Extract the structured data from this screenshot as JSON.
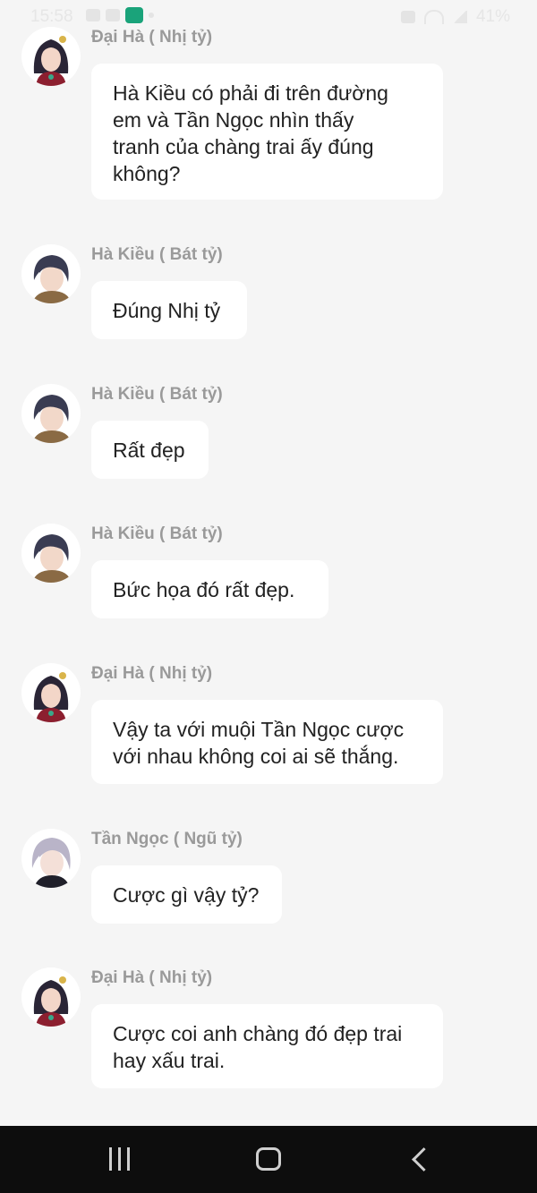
{
  "status_bar": {
    "time": "15:58",
    "battery": "41%"
  },
  "messages": [
    {
      "sender": "Đại Hà ( Nhị tỷ)",
      "lines": [
        "Hà Kiều có phải đi trên đường",
        "em và Tần Ngọc nhìn thấy",
        "tranh của chàng trai ấy đúng",
        "không?"
      ]
    },
    {
      "sender": "Hà Kiều ( Bát tỷ)",
      "lines": [
        "Đúng Nhị tỷ"
      ]
    },
    {
      "sender": "Hà Kiều ( Bát tỷ)",
      "lines": [
        "Rất đẹp"
      ]
    },
    {
      "sender": "Hà Kiều ( Bát tỷ)",
      "lines": [
        "Bức họa đó rất đẹp."
      ]
    },
    {
      "sender": "Đại Hà ( Nhị tỷ)",
      "lines": [
        "Vậy ta với muội Tần Ngọc cược",
        "với nhau không coi ai sẽ thắng."
      ]
    },
    {
      "sender": "Tần Ngọc ( Ngũ tỷ)",
      "lines": [
        "Cược gì vậy tỷ?"
      ]
    },
    {
      "sender": "Đại Hà ( Nhị tỷ)",
      "lines": [
        "Cược coi anh chàng đó đẹp trai",
        "hay xấu trai."
      ]
    }
  ]
}
